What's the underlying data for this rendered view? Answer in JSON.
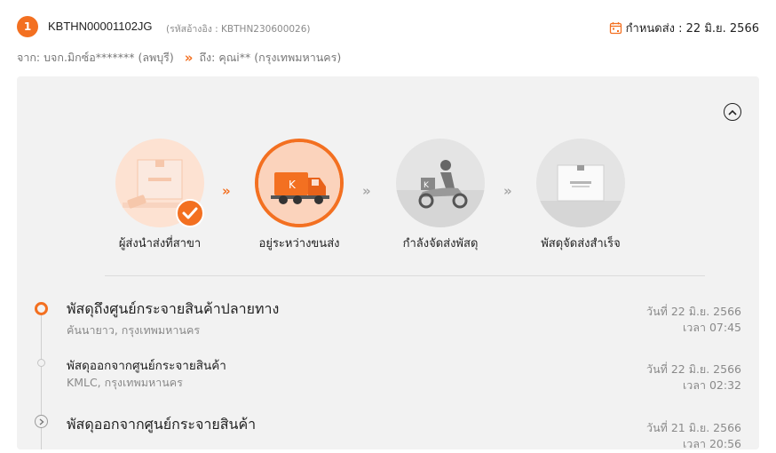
{
  "order": {
    "index": "1",
    "tracking_no": "KBTHN00001102JG",
    "ref_text": "(รหัสอ้างอิง : KBTHN230600026)",
    "deadline_text": "กำหนดส่ง : 22 มิ.ย. 2566"
  },
  "route": {
    "from_label": "จาก:",
    "from_value": "บจก.มิกซ์อ******* (ลพบุรี)",
    "to_label": "ถึง:",
    "to_value": "คุณi** (กรุงเทพมหานคร)"
  },
  "steps": [
    {
      "label": "ผู้ส่งนำส่งที่สาขา",
      "status": "done"
    },
    {
      "label": "อยู่ระหว่างขนส่ง",
      "status": "current"
    },
    {
      "label": "กำลังจัดส่งพัสดุ",
      "status": "pending"
    },
    {
      "label": "พัสดุจัดส่งสำเร็จ",
      "status": "pending"
    }
  ],
  "events": [
    {
      "title": "พัสดุถึงศูนย์กระจายสินค้าปลายทาง",
      "location": "คันนายาว, กรุงเทพมหานคร",
      "date": "วันที่ 22 มิ.ย. 2566",
      "time": "เวลา 07:45"
    },
    {
      "title": "พัสดุออกจากศูนย์กระจายสินค้า",
      "location": "KMLC, กรุงเทพมหานคร",
      "date": "วันที่ 22 มิ.ย. 2566",
      "time": "เวลา 02:32"
    },
    {
      "title": "พัสดุออกจากศูนย์กระจายสินค้า",
      "location": "",
      "date": "วันที่ 21 มิ.ย. 2566",
      "time": "เวลา 20:56"
    }
  ],
  "colors": {
    "accent": "#f37021",
    "panel": "#f2f2f2",
    "muted": "#8a8a8a"
  }
}
